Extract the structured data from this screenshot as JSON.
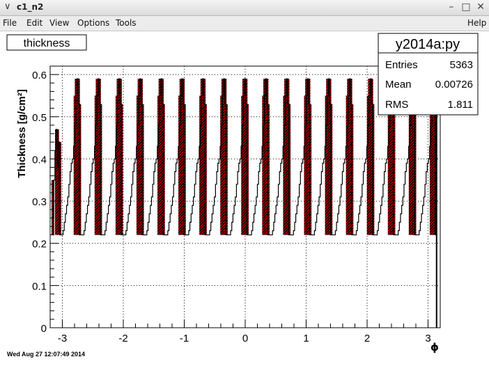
{
  "window": {
    "title": "c1_n2"
  },
  "menu": {
    "file": "File",
    "edit": "Edit",
    "view": "View",
    "options": "Options",
    "tools": "Tools",
    "help": "Help"
  },
  "chart_title": "thickness",
  "stats": {
    "name": "y2014a:py",
    "entries_label": "Entries",
    "entries_value": "5363",
    "mean_label": "Mean",
    "mean_value": "0.00726",
    "rms_label": "RMS",
    "rms_value": "1.811"
  },
  "footer": {
    "date": "Wed Aug 27 12:07:49 2014"
  },
  "colors": {
    "line": "#000000",
    "fill_pattern": "#cc0000",
    "grid": "#000000"
  },
  "chart_data": {
    "type": "line",
    "ylabel": "Thickness [g/cm²]",
    "xlabel": "ϕ",
    "xlim": [
      -3.2,
      3.2
    ],
    "ylim": [
      0,
      0.62
    ],
    "x_ticks": [
      "-3",
      "-2",
      "-1",
      "0",
      "1",
      "2",
      "3"
    ],
    "y_ticks": [
      "0",
      "0.1",
      "0.2",
      "0.3",
      "0.4",
      "0.5",
      "0.6"
    ],
    "grid": true,
    "periods": 18,
    "period_profile": [
      0.22,
      0.22,
      0.22,
      0.23,
      0.25,
      0.27,
      0.29,
      0.31,
      0.34,
      0.37,
      0.39,
      0.4,
      0.43,
      0.48,
      0.55,
      0.59,
      0.53,
      0.22
    ],
    "start_phase_values": [
      0.26,
      0.35,
      0.42,
      0.47,
      0.38,
      0.44
    ],
    "end_drop_x": 3.14
  }
}
